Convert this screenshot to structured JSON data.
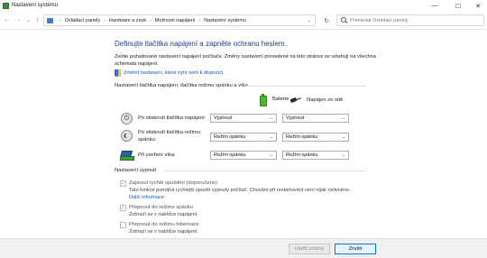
{
  "window": {
    "title": "Nastavení systému"
  },
  "controls": {
    "minimize": "—",
    "maximize": "☐",
    "close": "✕"
  },
  "address": {
    "back": "←",
    "forward": "→",
    "recent": "⌄",
    "up": "↑",
    "crumbs": [
      "Ovládací panely",
      "Hardware a zvuk",
      "Možnosti napájení",
      "Nastavení systému"
    ],
    "crumb_separator": "›",
    "dropdown": "⌄",
    "refresh": "↻",
    "search_placeholder": "Prohledat Ovládací panely"
  },
  "main": {
    "heading": "Definujte tlačítka napájení a zapněte ochranu heslem.",
    "intro": "Zvolte požadované nastavení napájení počítače. Změny nastavení provedené na této stránce se vztahují na všechna schémata napájení.",
    "change_link": "Změnit nastavení, které nyní není k dispozici",
    "buttons_section": "Nastavení tlačítka napájení, tlačítka režimu spánku a víka",
    "col_battery": "Baterie",
    "col_plugged": "Napájen ze sítě",
    "rows": [
      {
        "label": "Po stisknutí tlačítka napájení:",
        "battery": "Vypnout",
        "plugged": "Vypnout"
      },
      {
        "label": "Po stisknutí tlačítka režimu spánku:",
        "battery": "Režim spánku",
        "plugged": "Režim spánku"
      },
      {
        "label": "Při zavření víka:",
        "battery": "Režim spánku",
        "plugged": "Režim spánku"
      }
    ],
    "shutdown_section": "Nastavení vypnutí",
    "shutdown": [
      {
        "label": "Zapnout rychlé spuštění (doporučeno)",
        "checked": true,
        "desc": "Tato funkce pomáhá rychlejší spustit vypnutý počítač. Chování při restartování není nijak ovlivněno.",
        "more_link": "Další informace"
      },
      {
        "label": "Přepnout do režimu spánku",
        "checked": true,
        "desc": "Zobrazí se v nabídce napájení."
      },
      {
        "label": "Přepnout do režimu hibernace",
        "checked": false,
        "desc": "Zobrazí se v nabídce napájení."
      }
    ],
    "chevron": "⌄",
    "check_mark": "✓"
  },
  "footer": {
    "save": "Uložit změny",
    "cancel": "Zrušit"
  },
  "colors": {
    "heading": "#1e3a8a",
    "link": "#0a58c6",
    "accent": "#0078d7"
  }
}
